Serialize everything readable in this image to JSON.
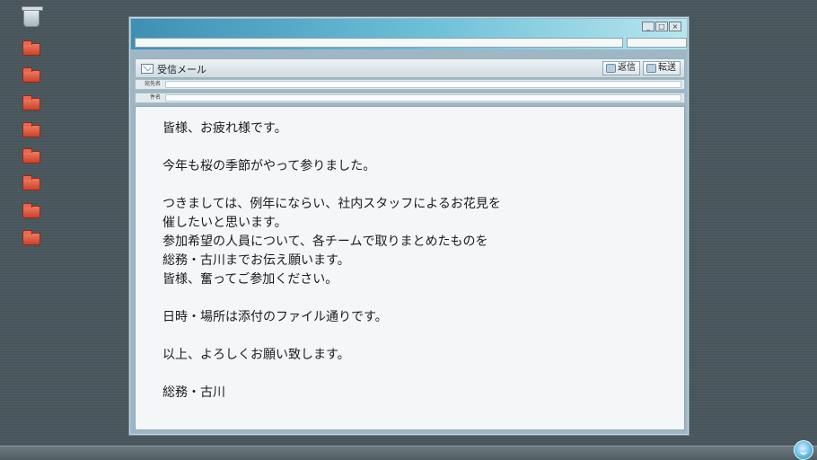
{
  "desktop": {
    "icons": [
      "trash-icon",
      "folder-icon",
      "folder-icon",
      "folder-icon",
      "folder-icon",
      "folder-icon",
      "folder-icon",
      "folder-icon",
      "folder-icon"
    ]
  },
  "window": {
    "controls": [
      "_",
      "□",
      "×"
    ],
    "mail": {
      "title": "受信メール",
      "reply_label": "返信",
      "forward_label": "転送",
      "to_label": "宛先名",
      "to_value": "",
      "subject_label": "件名",
      "subject_value": "",
      "body": "皆様、お疲れ様です。\n\n今年も桜の季節がやって参りました。\n\nつきましては、例年にならい、社内スタッフによるお花見を\n催したいと思います。\n参加希望の人員について、各チームで取りまとめたものを\n総務・古川までお伝え願います。\n皆様、奮ってご参加ください。\n\n日時・場所は添付のファイル通りです。\n\n以上、よろしくお願い致します。\n\n総務・古川"
    }
  },
  "colors": {
    "titlebar_start": "#3f8fb5",
    "titlebar_end": "#b7e6ef",
    "folder": "#e05a41",
    "desktop": "#4c5a60"
  }
}
